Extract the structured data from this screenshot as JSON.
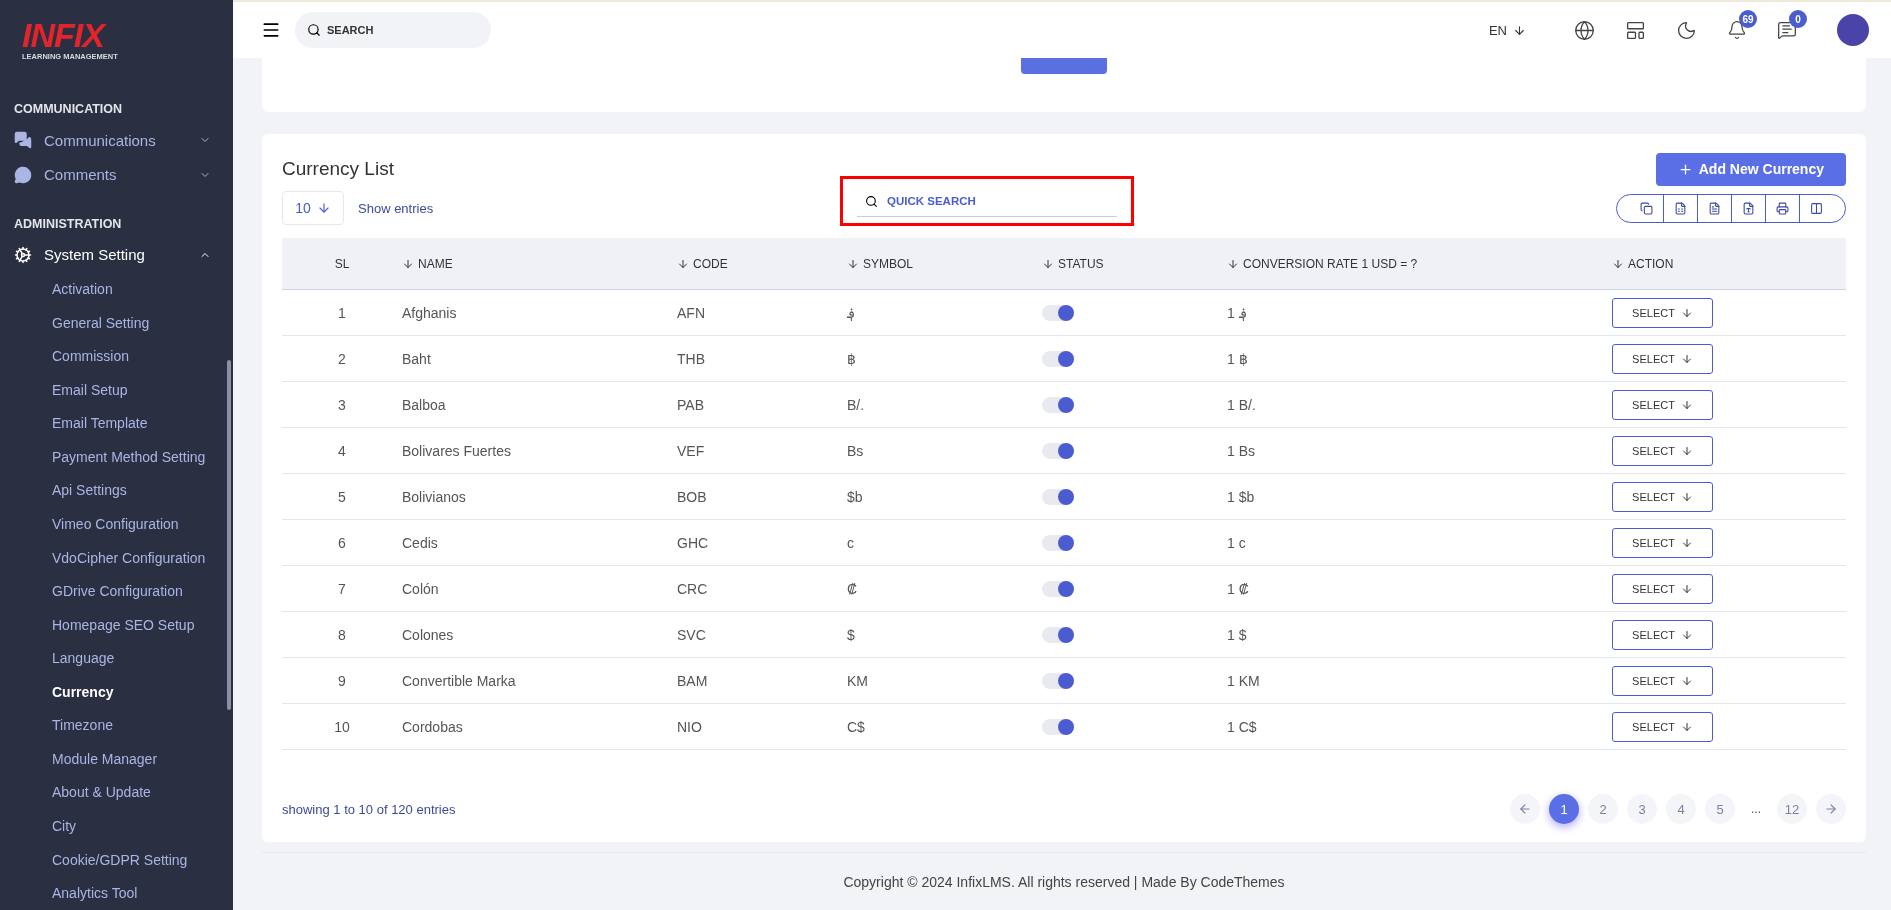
{
  "sidebar": {
    "logo": {
      "mark": "INFIX",
      "subtitle": "LEARNING MANAGEMENT"
    },
    "sections": [
      {
        "title": "COMMUNICATION",
        "items": [
          {
            "label": "Communications",
            "kind": "chats",
            "expanded": false
          },
          {
            "label": "Comments",
            "kind": "comment",
            "expanded": false
          }
        ]
      },
      {
        "title": "ADMINISTRATION",
        "items": [
          {
            "label": "System Setting",
            "kind": "gears",
            "expanded": true,
            "children": [
              {
                "label": "Activation",
                "selected": false
              },
              {
                "label": "General Setting",
                "selected": false
              },
              {
                "label": "Commission",
                "selected": false
              },
              {
                "label": "Email Setup",
                "selected": false
              },
              {
                "label": "Email Template",
                "selected": false
              },
              {
                "label": "Payment Method Setting",
                "selected": false
              },
              {
                "label": "Api Settings",
                "selected": false
              },
              {
                "label": "Vimeo Configuration",
                "selected": false
              },
              {
                "label": "VdoCipher Configuration",
                "selected": false
              },
              {
                "label": "GDrive Configuration",
                "selected": false
              },
              {
                "label": "Homepage SEO Setup",
                "selected": false
              },
              {
                "label": "Language",
                "selected": false
              },
              {
                "label": "Currency",
                "selected": true
              },
              {
                "label": "Timezone",
                "selected": false
              },
              {
                "label": "Module Manager",
                "selected": false
              },
              {
                "label": "About & Update",
                "selected": false
              },
              {
                "label": "City",
                "selected": false
              },
              {
                "label": "Cookie/GDPR Setting",
                "selected": false
              },
              {
                "label": "Analytics Tool",
                "selected": false
              }
            ]
          }
        ]
      }
    ]
  },
  "header": {
    "search": {
      "placeholder": "SEARCH"
    },
    "language": "EN",
    "notifications_count": "69",
    "messages_count": "0"
  },
  "currency_list": {
    "title": "Currency List",
    "add_button": "Add New Currency",
    "page_size": "10",
    "show_entries": "Show entries",
    "quick_search": {
      "placeholder": "QUICK SEARCH"
    },
    "table": {
      "columns": [
        "SL",
        "NAME",
        "CODE",
        "SYMBOL",
        "STATUS",
        "CONVERSION RATE 1 USD = ?",
        "ACTION"
      ],
      "rows": [
        {
          "sl": "1",
          "name": "Afghanis",
          "code": "AFN",
          "symbol": "؋",
          "on": true,
          "rate": "1 ؋",
          "action": "SELECT"
        },
        {
          "sl": "2",
          "name": "Baht",
          "code": "THB",
          "symbol": "฿",
          "on": true,
          "rate": "1 ฿",
          "action": "SELECT"
        },
        {
          "sl": "3",
          "name": "Balboa",
          "code": "PAB",
          "symbol": "B/.",
          "on": true,
          "rate": "1 B/.",
          "action": "SELECT"
        },
        {
          "sl": "4",
          "name": "Bolivares Fuertes",
          "code": "VEF",
          "symbol": "Bs",
          "on": true,
          "rate": "1 Bs",
          "action": "SELECT"
        },
        {
          "sl": "5",
          "name": "Bolivianos",
          "code": "BOB",
          "symbol": "$b",
          "on": true,
          "rate": "1 $b",
          "action": "SELECT"
        },
        {
          "sl": "6",
          "name": "Cedis",
          "code": "GHC",
          "symbol": "c",
          "on": true,
          "rate": "1 c",
          "action": "SELECT"
        },
        {
          "sl": "7",
          "name": "Colón",
          "code": "CRC",
          "symbol": "₡",
          "on": true,
          "rate": "1 ₡",
          "action": "SELECT"
        },
        {
          "sl": "8",
          "name": "Colones",
          "code": "SVC",
          "symbol": "$",
          "on": true,
          "rate": "1 $",
          "action": "SELECT"
        },
        {
          "sl": "9",
          "name": "Convertible Marka",
          "code": "BAM",
          "symbol": "KM",
          "on": true,
          "rate": "1 KM",
          "action": "SELECT"
        },
        {
          "sl": "10",
          "name": "Cordobas",
          "code": "NIO",
          "symbol": "C$",
          "on": true,
          "rate": "1 C$",
          "action": "SELECT"
        }
      ]
    },
    "summary": "showing 1 to 10 of 120 entries",
    "pagination": [
      {
        "kind": "prev"
      },
      {
        "kind": "page",
        "label": "1",
        "selected": true
      },
      {
        "kind": "page",
        "label": "2",
        "selected": false
      },
      {
        "kind": "page",
        "label": "3",
        "selected": false
      },
      {
        "kind": "page",
        "label": "4",
        "selected": false
      },
      {
        "kind": "page",
        "label": "5",
        "selected": false
      },
      {
        "kind": "ellipsis",
        "label": "..."
      },
      {
        "kind": "page",
        "label": "12",
        "selected": false
      },
      {
        "kind": "next"
      }
    ]
  },
  "footer": "Copyright © 2024 InfixLMS. All rights reserved | Made By CodeThemes"
}
